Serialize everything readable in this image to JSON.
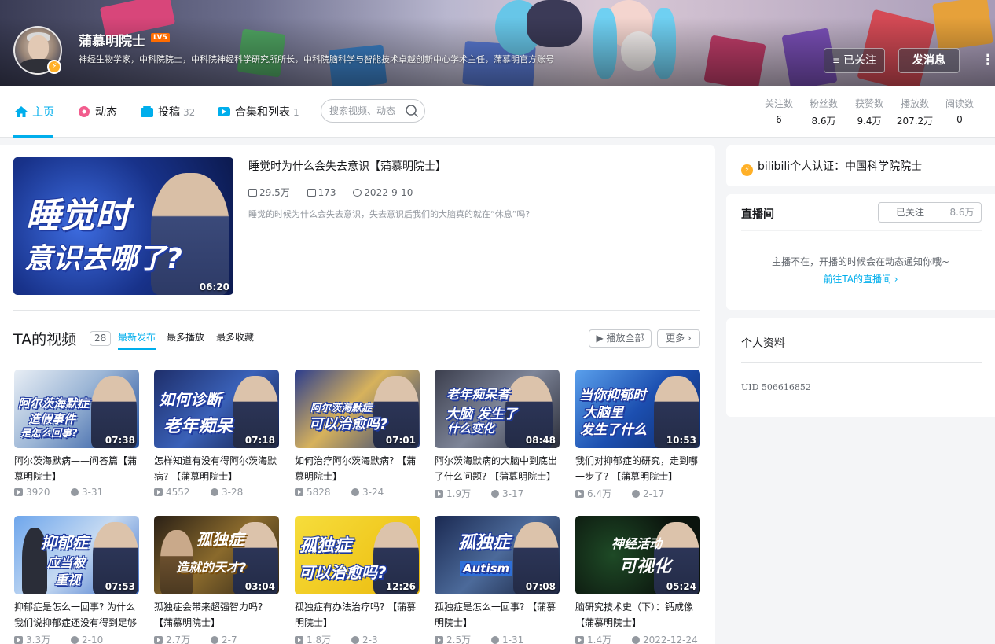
{
  "profile": {
    "name": "蒲慕明院士",
    "level": "LV5",
    "signature": "神经生物学家，中科院院士，中科院神经科学研究所所长，中科院脑科学与智能技术卓越创新中心学术主任，蒲慕明官方账号",
    "followed_label": "已关注",
    "message_label": "发消息"
  },
  "nav": {
    "items": [
      {
        "label": "主页",
        "count": ""
      },
      {
        "label": "动态",
        "count": ""
      },
      {
        "label": "投稿",
        "count": "32"
      },
      {
        "label": "合集和列表",
        "count": "1"
      }
    ],
    "search_placeholder": "搜索视频、动态"
  },
  "stats": [
    {
      "label": "关注数",
      "value": "6"
    },
    {
      "label": "粉丝数",
      "value": "8.6万"
    },
    {
      "label": "获赞数",
      "value": "9.4万"
    },
    {
      "label": "播放数",
      "value": "207.2万"
    },
    {
      "label": "阅读数",
      "value": "0"
    }
  ],
  "top_video": {
    "title": "睡觉时为什么会失去意识【蒲慕明院士】",
    "views": "29.5万",
    "danmaku": "173",
    "date": "2022-9-10",
    "desc": "睡觉的时候为什么会失去意识，失去意识后我们的大脑真的就在“休息”吗?",
    "duration": "06:20",
    "caption1": "睡觉时",
    "caption2": "意识去哪了?"
  },
  "videos_section": {
    "title": "TA的视频",
    "count": "28",
    "sorts": [
      "最新发布",
      "最多播放",
      "最多收藏"
    ],
    "play_all": "播放全部",
    "more": "更多"
  },
  "videos": [
    {
      "title": "阿尔茨海默病——问答篇【蒲慕明院士】",
      "views": "3920",
      "date": "3-31",
      "duration": "07:38",
      "cap1": "阿尔茨海默症",
      "cap2": "造假事件",
      "cap3": "是怎么回事?"
    },
    {
      "title": "怎样知道有没有得阿尔茨海默病? 【蒲慕明院士】",
      "views": "4552",
      "date": "3-28",
      "duration": "07:18",
      "cap1": "如何诊断",
      "cap2": "老年痴呆",
      "cap3": ""
    },
    {
      "title": "如何治疗阿尔茨海默病? 【蒲慕明院士】",
      "views": "5828",
      "date": "3-24",
      "duration": "07:01",
      "cap1": "阿尔茨海默症",
      "cap2": "可以治愈吗?",
      "cap3": ""
    },
    {
      "title": "阿尔茨海默病的大脑中到底出了什么问题? 【蒲慕明院士】",
      "views": "1.9万",
      "date": "3-17",
      "duration": "08:48",
      "cap1": "老年痴呆者",
      "cap2": "大脑 发生了",
      "cap3": "什么变化"
    },
    {
      "title": "我们对抑郁症的研究，走到哪一步了? 【蒲慕明院士】",
      "views": "6.4万",
      "date": "2-17",
      "duration": "10:53",
      "cap1": "当你抑郁时",
      "cap2": "大脑里",
      "cap3": "发生了什么"
    },
    {
      "title": "抑郁症是怎么一回事? 为什么我们说抑郁症还没有得到足够",
      "views": "3.3万",
      "date": "2-10",
      "duration": "07:53",
      "cap1": "抑郁症",
      "cap2": "应当被",
      "cap3": "重视"
    },
    {
      "title": "孤独症会带来超强智力吗? 【蒲慕明院士】",
      "views": "2.7万",
      "date": "2-7",
      "duration": "03:04",
      "cap1": "孤独症",
      "cap2": "造就的天才?",
      "cap3": ""
    },
    {
      "title": "孤独症有办法治疗吗? 【蒲慕明院士】",
      "views": "1.8万",
      "date": "2-3",
      "duration": "12:26",
      "cap1": "孤独症",
      "cap2": "可以治愈吗?",
      "cap3": ""
    },
    {
      "title": "孤独症是怎么一回事? 【蒲慕明院士】",
      "views": "2.5万",
      "date": "1-31",
      "duration": "07:08",
      "cap1": "孤独症",
      "cap2": "Autism",
      "cap3": ""
    },
    {
      "title": "脑研究技术史（下）：钙成像【蒲慕明院士】",
      "views": "1.4万",
      "date": "2022-12-24",
      "duration": "05:24",
      "cap1": "神经活动",
      "cap2": "可视化",
      "cap3": ""
    }
  ],
  "side": {
    "auth": "bilibili个人认证：中国科学院院士",
    "live_title": "直播间",
    "live_followed": "已关注",
    "live_fans": "8.6万",
    "live_msg": "主播不在，开播的时候会在动态通知你哦~",
    "live_go": "前往TA的直播间",
    "profile_title": "个人资料",
    "uid": "UID  506616852"
  },
  "colors": {
    "accent": "#00aeec",
    "text": "#18191c",
    "muted": "#9499a0"
  }
}
